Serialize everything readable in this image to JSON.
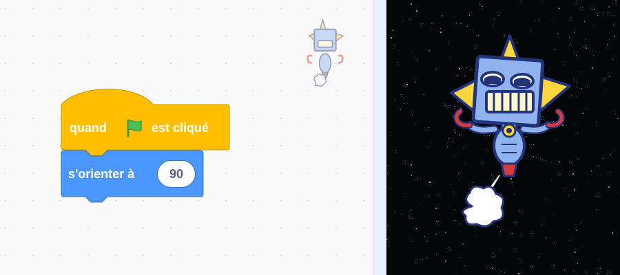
{
  "blocks": {
    "hat": {
      "prefix": "quand",
      "suffix": "est cliqué",
      "icon": "green-flag-icon",
      "color": "#ffbf00",
      "border": "#cc9900"
    },
    "motion": {
      "label": "s'orienter à",
      "value": "90",
      "color": "#4c97ff",
      "border": "#3373cc"
    }
  },
  "stage": {
    "background": "space",
    "sprite": "robot"
  },
  "colors": {
    "flag_green": "#4cbf56",
    "robot_blue": "#8fb3ef",
    "robot_outline": "#23347a",
    "robot_yellow": "#ffd53d",
    "robot_red": "#d63a3a"
  }
}
